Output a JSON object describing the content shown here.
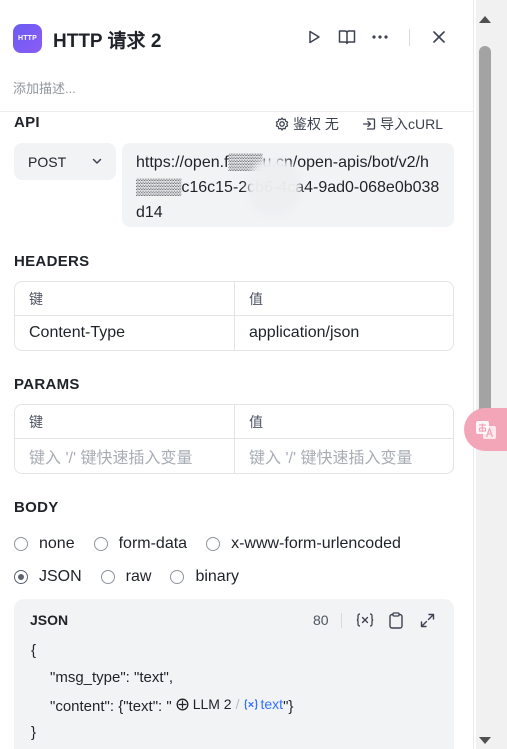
{
  "header": {
    "app_icon_text": "HTTP",
    "title": "HTTP 请求 2",
    "description_placeholder": "添加描述..."
  },
  "api": {
    "section_title": "API",
    "auth_label": "鉴权 无",
    "import_curl_label": "导入cURL",
    "method": "POST",
    "url": "https://open.f▒▒▒u.cn/open-apis/bot/v2/h▒▒▒▒c16c15-2cb6-4ca4-9ad0-068e0b038d14"
  },
  "headers": {
    "section_title": "HEADERS",
    "col_key": "键",
    "col_value": "值",
    "rows": [
      {
        "key": "Content-Type",
        "value": "application/json"
      }
    ]
  },
  "params": {
    "section_title": "PARAMS",
    "col_key": "键",
    "col_value": "值",
    "key_placeholder": "键入 '/' 键快速插入变量",
    "value_placeholder": "键入 '/' 键快速插入变量"
  },
  "body": {
    "section_title": "BODY",
    "options_row1": [
      "none",
      "form-data",
      "x-www-form-urlencoded"
    ],
    "options_row2": [
      "JSON",
      "raw",
      "binary"
    ],
    "selected": "JSON",
    "json": {
      "title": "JSON",
      "count": "80",
      "line1": "{",
      "line2": "\"msg_type\": \"text\",",
      "line3_prefix": "\"content\": {\"text\":  \"",
      "chip_node": "LLM 2",
      "chip_var": "text",
      "line3_suffix": "\"}",
      "line4": "}"
    }
  },
  "colors": {
    "accent": "#3370ff",
    "icon_gradient_start": "#6a5cf2",
    "fab": "#f4a6b9"
  }
}
